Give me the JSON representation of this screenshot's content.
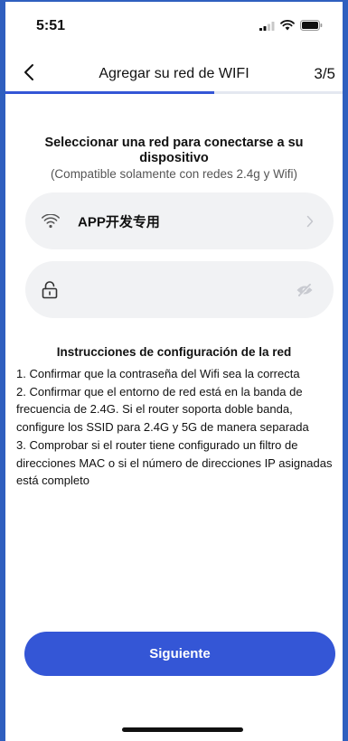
{
  "status_bar": {
    "time": "5:51"
  },
  "nav": {
    "title": "Agregar su red de WIFI",
    "step": "3/5",
    "progress": 0.62
  },
  "heading": "Seleccionar una red para conectarse a su dispositivo",
  "subheading": "(Compatible solamente con redes 2.4g y Wifi)",
  "wifi_field": {
    "network_name": "APP开发专用",
    "icon": "wifi-icon"
  },
  "password_field": {
    "value": "",
    "placeholder": "",
    "icon": "lock-icon",
    "toggle_icon": "eye-off-icon"
  },
  "instructions": {
    "title": "Instrucciones de configuración de la red",
    "items": [
      "1. Confirmar que la contraseña del Wifi sea la correcta",
      "2. Confirmar que el entorno de red está en la banda de frecuencia de 2.4G. Si el router soporta doble banda, configure los SSID para 2.4G y 5G de manera separada",
      "3. Comprobar si el router tiene configurado un filtro de direcciones MAC o si el número de direcciones IP asignadas está completo"
    ]
  },
  "next_button": {
    "label": "Siguiente"
  },
  "colors": {
    "accent": "#3456d6",
    "field_bg": "#f1f2f4",
    "frame": "#2f5fbf"
  }
}
